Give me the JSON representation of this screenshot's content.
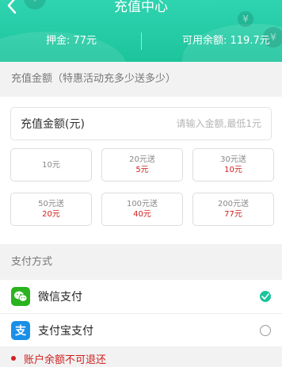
{
  "header": {
    "title": "充值中心",
    "deposit_text": "押金: 77元",
    "balance_text": "可用余额: 119.7元",
    "coin_symbol": "¥",
    "plus_symbol": "+"
  },
  "amount_section": {
    "label": "充值金额（特惠活动充多少送多少）",
    "input_label": "充值金额(元)",
    "input_placeholder": "请输入金额,最低1元",
    "options": [
      {
        "main": "10元",
        "bonus": ""
      },
      {
        "main": "20元送",
        "bonus": "5元"
      },
      {
        "main": "30元送",
        "bonus": "10元"
      },
      {
        "main": "50元送",
        "bonus": "20元"
      },
      {
        "main": "100元送",
        "bonus": "40元"
      },
      {
        "main": "200元送",
        "bonus": "77元"
      }
    ]
  },
  "payment_section": {
    "label": "支付方式",
    "methods": [
      {
        "name": "微信支付",
        "icon": "wechat-pay-icon",
        "selected": true,
        "color": "#2ab31e"
      },
      {
        "name": "支付宝支付",
        "icon": "alipay-icon",
        "selected": false,
        "color": "#1a8fe8"
      }
    ]
  },
  "notice": {
    "text": "账户余额不可退还"
  },
  "colors": {
    "accent": "#1cc49c",
    "warning": "#d02020"
  }
}
